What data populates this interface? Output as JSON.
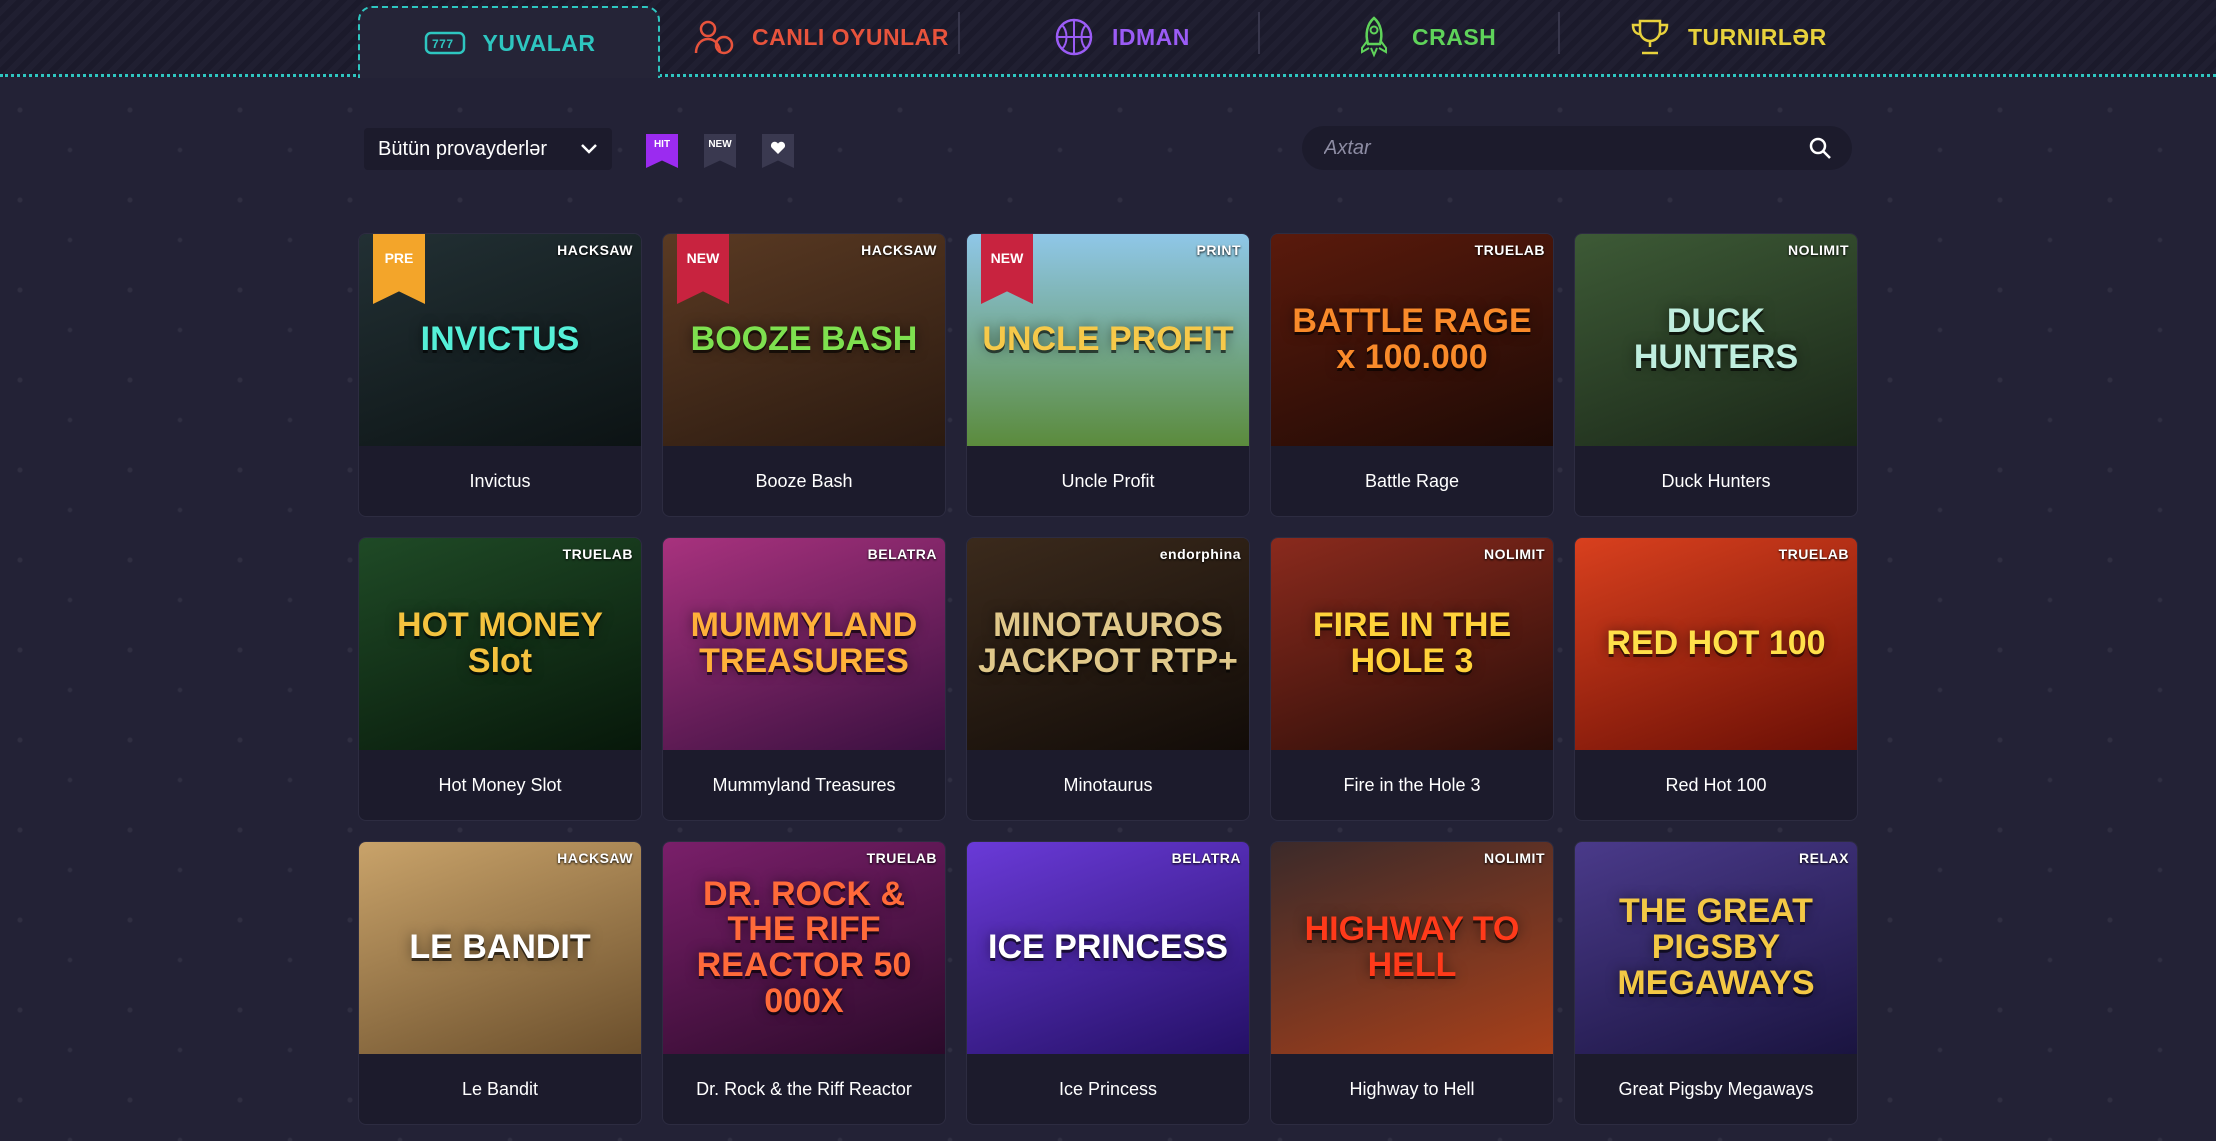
{
  "nav": {
    "tabs": [
      {
        "label": "YUVALAR",
        "color": "#2ec6c0",
        "icon": "slot-machine-icon",
        "active": true
      },
      {
        "label": "CANLI OYUNLAR",
        "color": "#e8533c",
        "icon": "live-dealer-icon",
        "active": false
      },
      {
        "label": "IDMAN",
        "color": "#9b5cf6",
        "icon": "basketball-icon",
        "active": false
      },
      {
        "label": "CRASH",
        "color": "#5fd35a",
        "icon": "rocket-icon",
        "active": false
      },
      {
        "label": "TURNIRLƏR",
        "color": "#e8d23c",
        "icon": "trophy-icon",
        "active": false
      }
    ]
  },
  "filters": {
    "provider_select": "Bütün provayderlər",
    "flags": [
      {
        "label": "HIT",
        "color": "#9b2bf0"
      },
      {
        "label": "NEW",
        "color": "#3a3950"
      },
      {
        "label": "",
        "color": "#3a3950",
        "icon": "heart-icon"
      }
    ],
    "search_placeholder": "Axtar"
  },
  "games": [
    {
      "name": "Invictus",
      "provider": "HACKSAW",
      "badge": "PRE",
      "art": "INVICTUS",
      "bg": "linear-gradient(160deg,#223034,#0c1314)",
      "art_color": "#55f0d8"
    },
    {
      "name": "Booze Bash",
      "provider": "HACKSAW",
      "badge": "NEW",
      "art": "BOOZE BASH",
      "bg": "linear-gradient(160deg,#5a3a23,#2b1a10)",
      "art_color": "#7ee04f"
    },
    {
      "name": "Uncle Profit",
      "provider": "PRINT",
      "badge": "NEW",
      "art": "UNCLE PROFIT",
      "bg": "linear-gradient(180deg,#8fc7e8,#5b8b3c)",
      "art_color": "#f6c94a"
    },
    {
      "name": "Battle Rage",
      "provider": "TRUELAB",
      "badge": "",
      "art": "BATTLE RAGE x 100.000",
      "bg": "linear-gradient(160deg,#5a1a0c,#1e0a05)",
      "art_color": "#f98a2a"
    },
    {
      "name": "Duck Hunters",
      "provider": "NOLIMIT",
      "badge": "",
      "art": "DUCK HUNTERS",
      "bg": "linear-gradient(160deg,#3d5a36,#1a2718)",
      "art_color": "#bfeede"
    },
    {
      "name": "Hot Money Slot",
      "provider": "TRUELAB",
      "badge": "",
      "art": "HOT MONEY Slot",
      "bg": "linear-gradient(160deg,#1f4a26,#07180a)",
      "art_color": "#f4c23e"
    },
    {
      "name": "Mummyland Treasures",
      "provider": "BELATRA",
      "badge": "",
      "art": "MUMMYLAND TREASURES",
      "bg": "linear-gradient(160deg,#a8327e,#3a1040)",
      "art_color": "#ffb13a"
    },
    {
      "name": "Minotaurus",
      "provider": "endorphina",
      "badge": "",
      "art": "MINOTAUROS JACKPOT RTP+",
      "bg": "linear-gradient(160deg,#3b2a1c,#120c08)",
      "art_color": "#e0c88a"
    },
    {
      "name": "Fire in the Hole 3",
      "provider": "NOLIMIT",
      "badge": "",
      "art": "FIRE IN THE HOLE 3",
      "bg": "linear-gradient(160deg,#8a2a1d,#2a0d08)",
      "art_color": "#ffd23a"
    },
    {
      "name": "Red Hot 100",
      "provider": "TRUELAB",
      "badge": "",
      "art": "RED HOT 100",
      "bg": "linear-gradient(160deg,#d9401e,#6a0f05)",
      "art_color": "#ffe04a"
    },
    {
      "name": "Le Bandit",
      "provider": "HACKSAW",
      "badge": "",
      "art": "LE BANDIT",
      "bg": "linear-gradient(160deg,#c9a36a,#6b4f2c)",
      "art_color": "#ffffff"
    },
    {
      "name": "Dr. Rock & the Riff Reactor",
      "provider": "TRUELAB",
      "badge": "",
      "art": "DR. ROCK & THE RIFF REACTOR 50 000X",
      "bg": "linear-gradient(160deg,#7a1f6a,#2b0a2a)",
      "art_color": "#ff6a3a"
    },
    {
      "name": "Ice Princess",
      "provider": "BELATRA",
      "badge": "",
      "art": "ICE PRINCESS",
      "bg": "linear-gradient(160deg,#6a3ad8,#241066)",
      "art_color": "#ffffff"
    },
    {
      "name": "Highway to Hell",
      "provider": "NOLIMIT",
      "badge": "",
      "art": "HIGHWAY TO HELL",
      "bg": "linear-gradient(160deg,#3b2a2a,#a8401a)",
      "art_color": "#ff3a1a"
    },
    {
      "name": "Great Pigsby Megaways",
      "provider": "RELAX",
      "badge": "",
      "art": "THE GREAT PIGSBY MEGAWAYS",
      "bg": "linear-gradient(160deg,#4a3a8a,#1a1440)",
      "art_color": "#f3c845"
    }
  ]
}
